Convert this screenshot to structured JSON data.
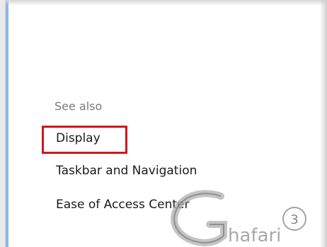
{
  "see_also": {
    "title": "See also",
    "links": [
      {
        "label": "Display",
        "highlighted": true
      },
      {
        "label": "Taskbar and Navigation"
      },
      {
        "label": "Ease of Access Center"
      }
    ]
  },
  "watermark": {
    "text": "Ghafari",
    "badge": "3"
  },
  "colors": {
    "highlight": "#d6121f",
    "panel_border": "#8fb7e0",
    "muted_text": "#7a7a7a"
  }
}
